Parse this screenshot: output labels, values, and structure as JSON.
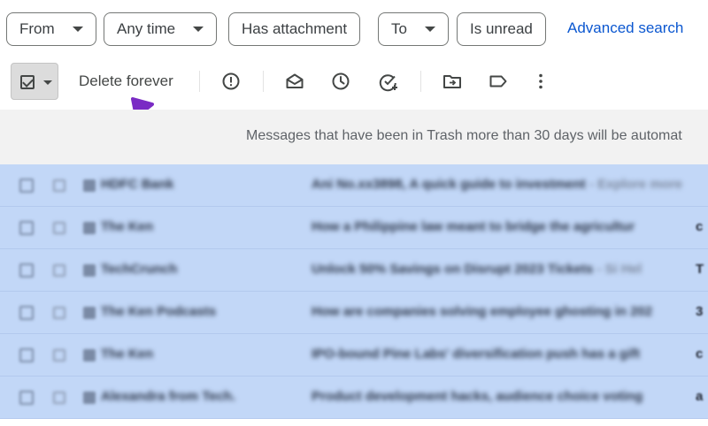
{
  "filters": {
    "from": "From",
    "any_time": "Any time",
    "has_attachment": "Has attachment",
    "to": "To",
    "is_unread": "Is unread",
    "advanced_search": "Advanced search"
  },
  "toolbar": {
    "delete_forever": "Delete forever",
    "icons": [
      "select-all-checkbox",
      "report-spam-icon",
      "mark-unread-icon",
      "snooze-icon",
      "add-to-tasks-icon",
      "move-to-icon",
      "label-icon",
      "more-options-icon"
    ]
  },
  "info_bar": {
    "message": "Messages that have been in Trash more than 30 days will be automat"
  },
  "emails": [
    {
      "sender": "HDFC Bank",
      "subject": "Ani No.xx3898, A quick guide to investment",
      "snippet": "- Explore more",
      "edge": ""
    },
    {
      "sender": "The Ken",
      "subject": "How a Philippine law meant to bridge the agricultur",
      "snippet": "",
      "edge": "c"
    },
    {
      "sender": "TechCrunch",
      "subject": "Unlock 50% Savings on Disrupt 2023 Tickets",
      "snippet": "- Si Hel",
      "edge": "T"
    },
    {
      "sender": "The Ken Podcasts",
      "subject": "How are companies solving employee ghosting in 202",
      "snippet": "",
      "edge": "3"
    },
    {
      "sender": "The Ken",
      "subject": "IPO-bound Pine Labs' diversification push has a gift",
      "snippet": "",
      "edge": "c"
    },
    {
      "sender": "Alexandra from Tech.",
      "subject": "Product development hacks, audience choice voting",
      "snippet": "",
      "edge": "a"
    }
  ],
  "colors": {
    "accent_link": "#0b57d0",
    "selected_row": "#c2d7f7",
    "annotation_arrow": "#7a2bc4"
  }
}
